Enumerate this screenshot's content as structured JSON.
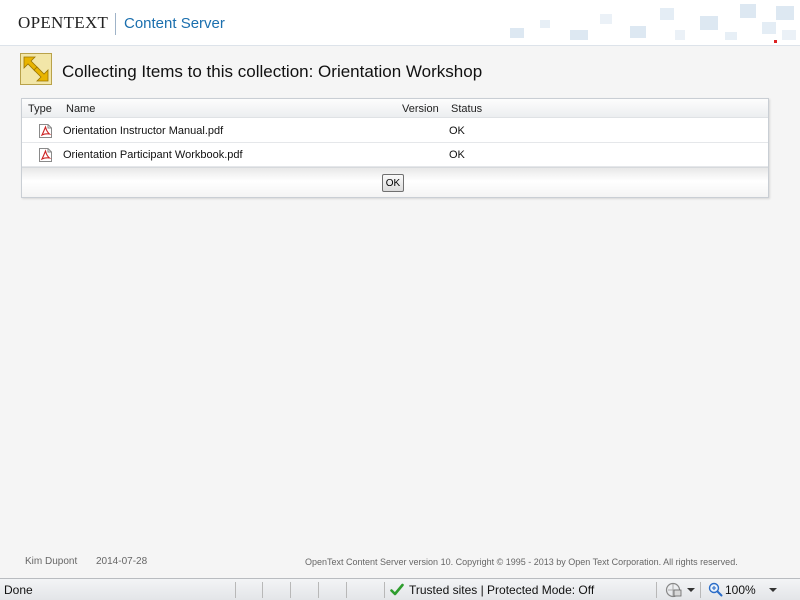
{
  "header": {
    "brand": "OPENTEXT",
    "product": "Content Server"
  },
  "page": {
    "title": "Collecting Items to this collection: Orientation Workshop"
  },
  "table": {
    "columns": {
      "type": "Type",
      "name": "Name",
      "version": "Version",
      "status": "Status"
    },
    "rows": [
      {
        "icon": "pdf-icon",
        "name": "Orientation Instructor Manual.pdf",
        "version": "",
        "status": "OK"
      },
      {
        "icon": "pdf-icon",
        "name": "Orientation Participant Workbook.pdf",
        "version": "",
        "status": "OK"
      }
    ],
    "ok_label": "OK"
  },
  "footer": {
    "user": "Kim Dupont",
    "date": "2014-07-28",
    "copyright": "OpenText Content Server version 10. Copyright © 1995 - 2013 by Open Text Corporation. All rights reserved."
  },
  "statusbar": {
    "status": "Done",
    "zone": "Trusted sites | Protected Mode: Off",
    "zoom": "100%"
  },
  "colors": {
    "accent": "#1b6fae",
    "trusted_check": "#2e9d2e",
    "pdf_red": "#cc2222"
  }
}
